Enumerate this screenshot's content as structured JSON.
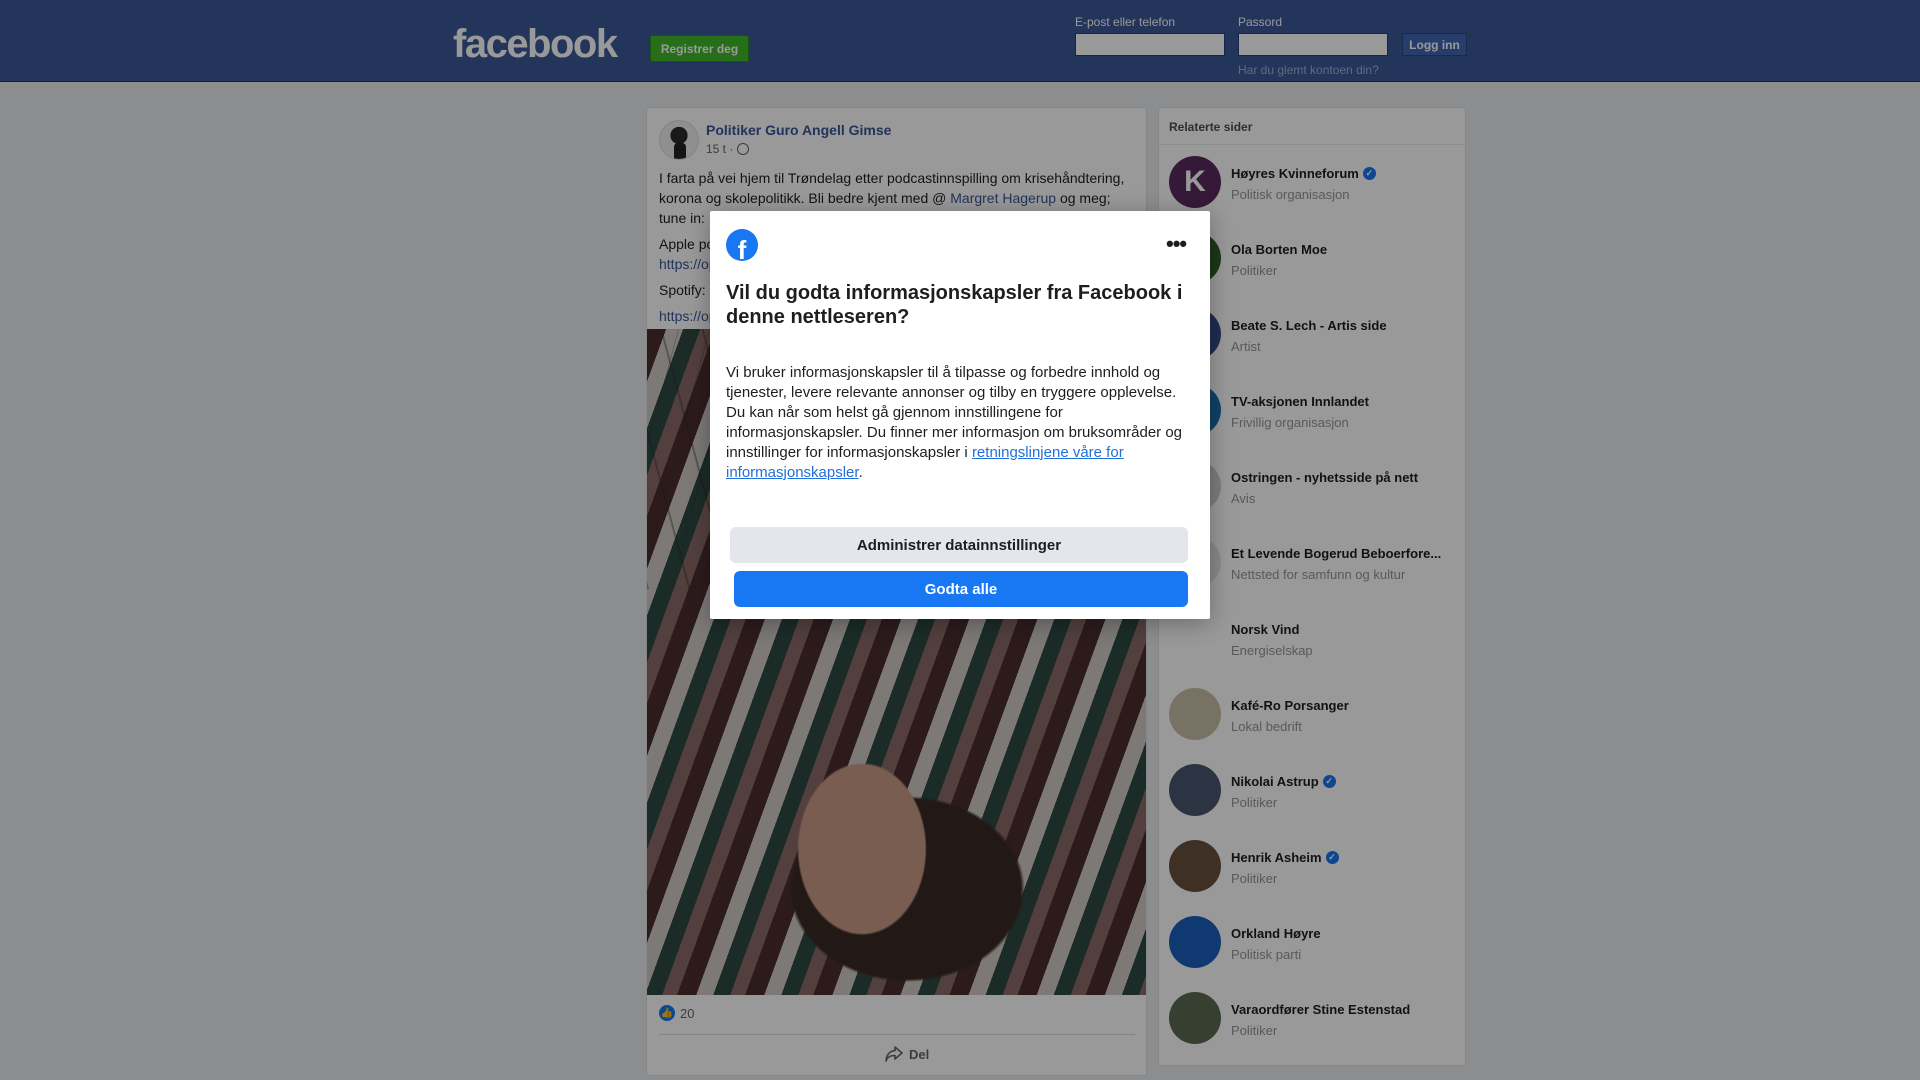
{
  "header": {
    "logo": "facebook",
    "register_label": "Registrer deg",
    "email_label": "E-post eller telefon",
    "password_label": "Passord",
    "login_label": "Logg inn",
    "forgot_label": "Har du glemt kontoen din?",
    "brand_color": "#3b5998"
  },
  "post": {
    "author": "Politiker Guro Angell Gimse",
    "time": "15 t ·",
    "text_line1": "I farta på vei hjem til Trøndelag etter podcastinnspilling om krisehåndtering, korona og skolepolitikk. Bli bedre kjent med @ ",
    "mention": "Margret Hagerup",
    "text_line1_end": " og meg; tune in:",
    "apple_label": "Apple po",
    "link1": "https://op",
    "spotify_label": "Spotify:",
    "link2": "https://op",
    "likes": "20",
    "share_label": "Del"
  },
  "related": {
    "title": "Relaterte sider",
    "items": [
      {
        "name": "Høyres Kvinneforum",
        "category": "Politisk organisasjon",
        "verified": true,
        "letter": "K",
        "color": "#5a2a5e"
      },
      {
        "name": "Ola Borten Moe",
        "category": "Politiker",
        "verified": false,
        "letter": "",
        "color": "#2f5e2a"
      },
      {
        "name": "Beate S. Lech - Artis side",
        "category": "Artist",
        "verified": false,
        "letter": "",
        "color": "#3a4a8a"
      },
      {
        "name": "TV-aksjonen Innlandet",
        "category": "Frivillig organisasjon",
        "verified": false,
        "letter": "",
        "color": "#1b6fa8"
      },
      {
        "name": "Ostringen - nyhetsside på nett",
        "category": "Avis",
        "verified": false,
        "letter": "",
        "color": "#d0d0d0"
      },
      {
        "name": "Et Levende Bogerud Beboerfore...",
        "category": "Nettsted for samfunn og kultur",
        "verified": false,
        "letter": "",
        "color": "#e6e6e6"
      },
      {
        "name": "Norsk Vind",
        "category": "Energiselskap",
        "verified": false,
        "letter": "",
        "color": "#ffffff"
      },
      {
        "name": "Kafé-Ro Porsanger",
        "category": "Lokal bedrift",
        "verified": false,
        "letter": "",
        "color": "#c8bfa8"
      },
      {
        "name": "Nikolai Astrup",
        "category": "Politiker",
        "verified": true,
        "letter": "",
        "color": "#4a5870"
      },
      {
        "name": "Henrik Asheim",
        "category": "Politiker",
        "verified": true,
        "letter": "",
        "color": "#6a5040"
      },
      {
        "name": "Orkland Høyre",
        "category": "Politisk parti",
        "verified": false,
        "letter": "",
        "color": "#1b5fbf"
      },
      {
        "name": "Varaordfører Stine Estenstad",
        "category": "Politiker",
        "verified": false,
        "letter": "",
        "color": "#5a6a50"
      }
    ]
  },
  "dialog": {
    "title": "Vil du godta informasjonskapsler fra Facebook i denne nettleseren?",
    "body": "Vi bruker informasjonskapsler til å tilpasse og forbedre innhold og tjenester, levere relevante annonser og tilby en tryggere opplevelse. Du kan når som helst gå gjennom innstillingene for informasjonskapsler. Du finner mer informasjon om bruksområder og innstillinger for informasjonskapsler i ",
    "link_text": "retningslinjene våre for informasjonskapsler",
    "body_end": ".",
    "manage_label": "Administrer datainnstillinger",
    "accept_label": "Godta alle",
    "accent_color": "#1877f2"
  }
}
